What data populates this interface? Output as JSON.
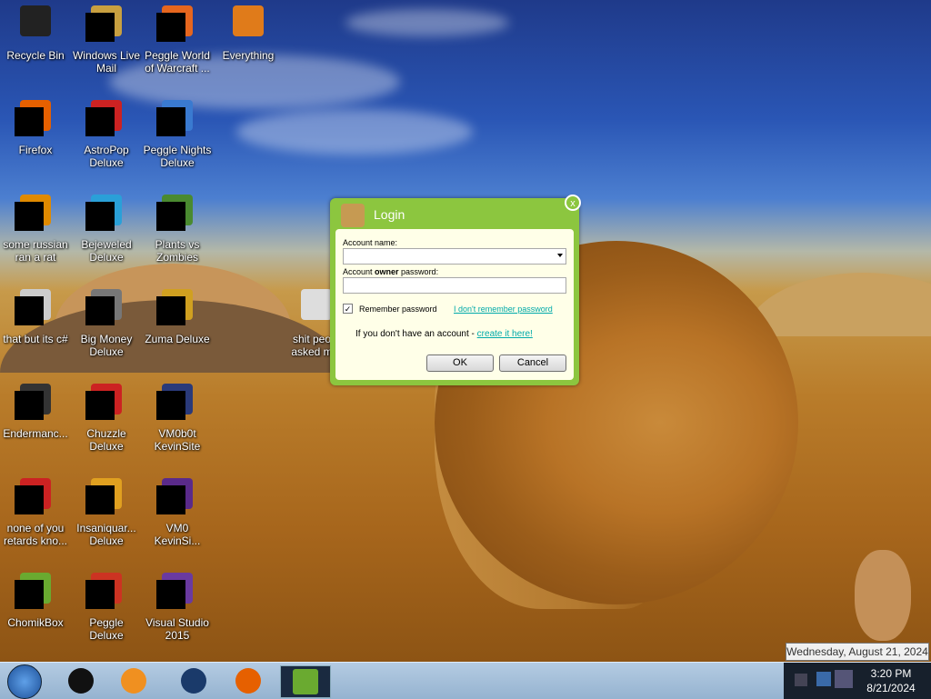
{
  "desktop_icons": [
    {
      "label": "Recycle Bin",
      "icon": "recycle-bin-icon",
      "color": "#222222"
    },
    {
      "label": "Windows Live Mail",
      "icon": "mail-icon",
      "color": "#c8a040"
    },
    {
      "label": "Peggle World of Warcraft ...",
      "icon": "peggle-icon",
      "color": "#e6661e"
    },
    {
      "label": "Everything",
      "icon": "search-icon",
      "color": "#e07b1a"
    },
    {
      "label": "Firefox",
      "icon": "firefox-icon",
      "color": "#e66000"
    },
    {
      "label": "AstroPop Deluxe",
      "icon": "astropop-icon",
      "color": "#cc2222"
    },
    {
      "label": "Peggle Nights Deluxe",
      "icon": "peggle-nights-icon",
      "color": "#3a7ad0"
    },
    {
      "label": "some russian ran a rat",
      "icon": "app-icon",
      "color": "#e08a00"
    },
    {
      "label": "Bejeweled Deluxe",
      "icon": "bejeweled-icon",
      "color": "#2aa0d8"
    },
    {
      "label": "Plants vs Zombies",
      "icon": "plants-vs-zombies-icon",
      "color": "#4a8a30"
    },
    {
      "label": "that but its c#",
      "icon": "app-icon",
      "color": "#cccccc"
    },
    {
      "label": "Big Money Deluxe",
      "icon": "big-money-icon",
      "color": "#777777"
    },
    {
      "label": "Zuma Deluxe",
      "icon": "zuma-icon",
      "color": "#d0a020"
    },
    {
      "label": "shit peo... asked m...",
      "icon": "folder-icon",
      "color": "#dddddd"
    },
    {
      "label": "Endermanc...",
      "icon": "app-icon",
      "color": "#333333"
    },
    {
      "label": "Chuzzle Deluxe",
      "icon": "chuzzle-icon",
      "color": "#cc2222"
    },
    {
      "label": "VM0b0t KevinSite",
      "icon": "vm-icon",
      "color": "#2a3a7a"
    },
    {
      "label": "none of you retards kno...",
      "icon": "app-icon",
      "color": "#cc2222"
    },
    {
      "label": "Insaniquar... Deluxe",
      "icon": "insaniquarium-icon",
      "color": "#e0a020"
    },
    {
      "label": "VM0 KevinSi...",
      "icon": "vm-icon",
      "color": "#5a2a8a"
    },
    {
      "label": "ChomikBox",
      "icon": "chomikbox-icon",
      "color": "#6aaa30"
    },
    {
      "label": "Peggle Deluxe",
      "icon": "peggle-icon",
      "color": "#cc3322"
    },
    {
      "label": "Visual Studio 2015",
      "icon": "visual-studio-icon",
      "color": "#6a3aa0"
    }
  ],
  "dialog": {
    "title": "Login",
    "account_name_label": "Account name:",
    "owner_password_label_pre": "Account ",
    "owner_password_label_bold": "owner",
    "owner_password_label_post": " password:",
    "remember_label": "Remember password",
    "remember_checked": true,
    "forgot_link": "I don't remember password",
    "no_account_text": "If you don't have an account - ",
    "create_link": "create it here!",
    "ok_label": "OK",
    "cancel_label": "Cancel",
    "close_glyph": "x"
  },
  "taskbar": {
    "pinned": [
      {
        "icon": "terminal-icon",
        "color": "#111111"
      },
      {
        "icon": "media-player-icon",
        "color": "#f09020"
      },
      {
        "icon": "globe-icon",
        "color": "#1a3a6a"
      },
      {
        "icon": "firefox-icon",
        "color": "#e66000"
      },
      {
        "icon": "chomikbox-icon",
        "color": "#6aaa30"
      }
    ],
    "time": "3:20 PM",
    "date": "8/21/2024",
    "tooltip": "Wednesday, August 21, 2024"
  },
  "colors": {
    "dialog_green": "#8cc63f",
    "link": "#00aaaa"
  }
}
